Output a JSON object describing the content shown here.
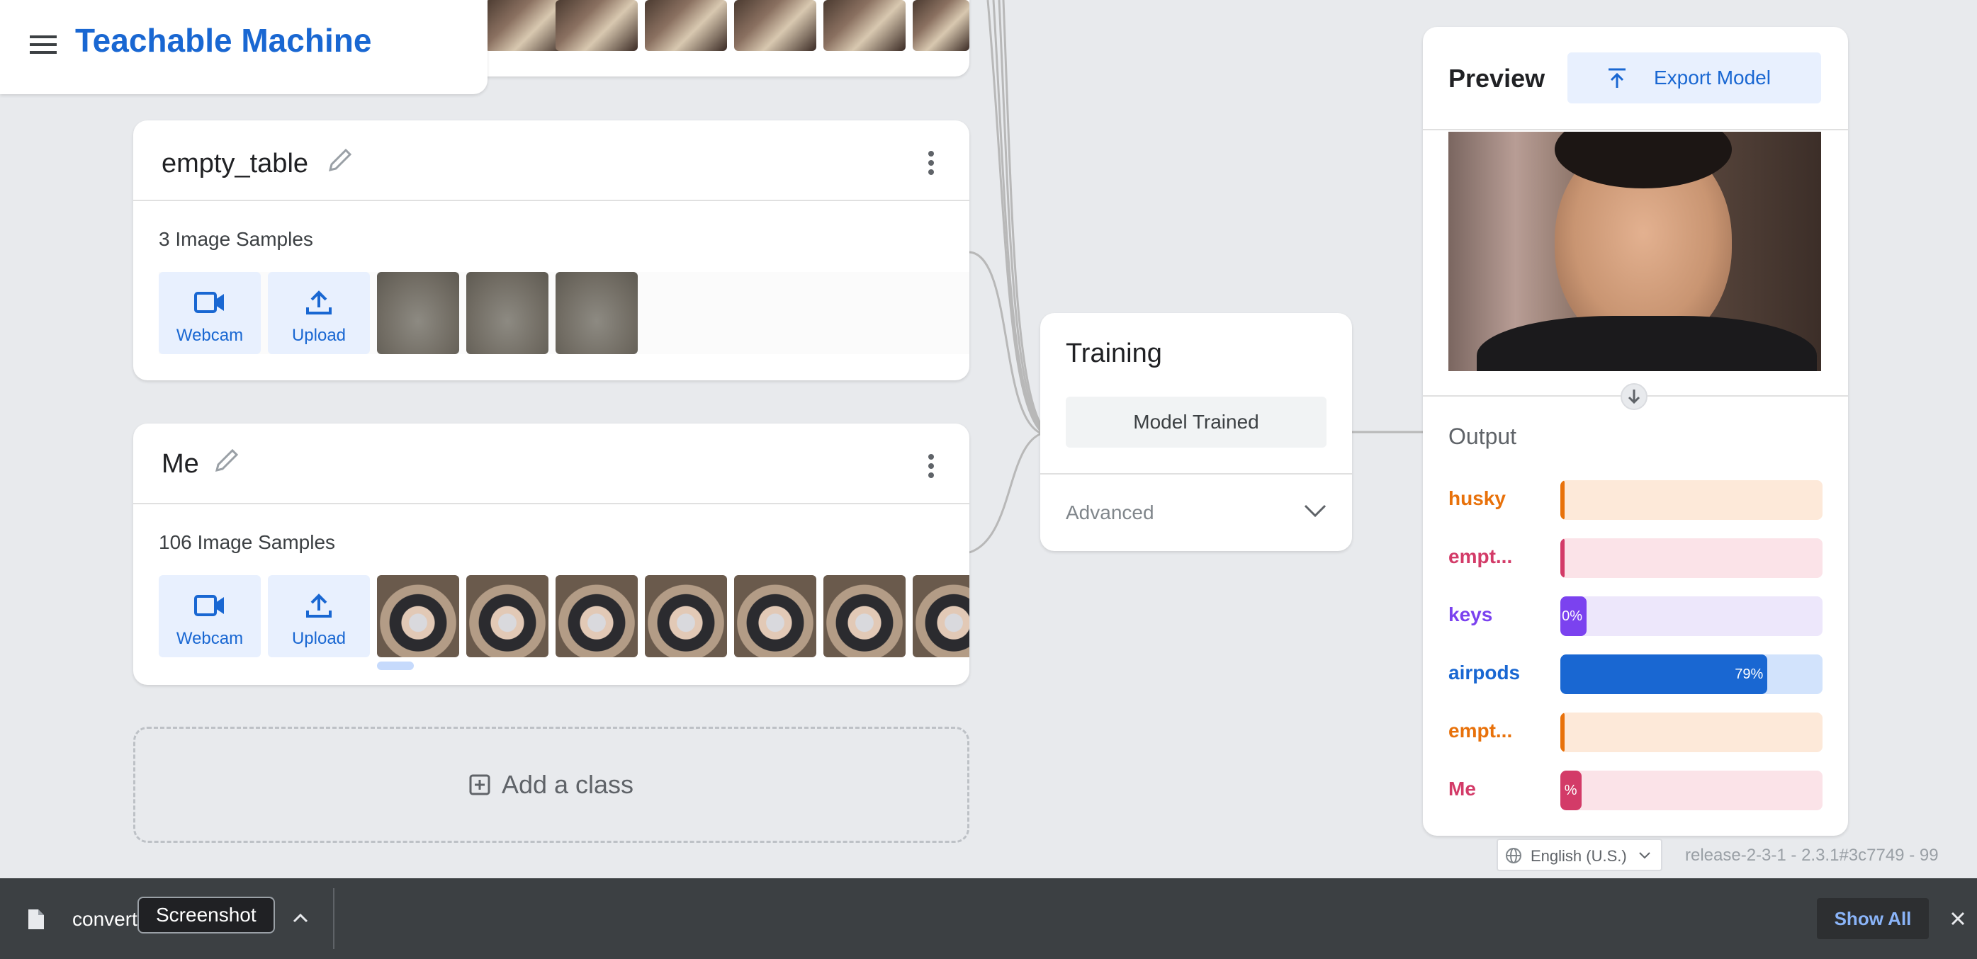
{
  "app": {
    "title": "Teachable Machine",
    "menu_icon": "hamburger-menu-icon"
  },
  "classes": [
    {
      "name": "empty_table",
      "sample_count_label": "3 Image Samples",
      "webcam_label": "Webcam",
      "upload_label": "Upload"
    },
    {
      "name": "Me",
      "sample_count_label": "106 Image Samples",
      "webcam_label": "Webcam",
      "upload_label": "Upload"
    }
  ],
  "add_class_label": "Add a class",
  "training": {
    "title": "Training",
    "status_button": "Model Trained",
    "advanced_label": "Advanced"
  },
  "preview": {
    "title": "Preview",
    "export_label": "Export Model",
    "output_title": "Output",
    "outputs": [
      {
        "label": "husky",
        "percent": 0,
        "percent_label": "",
        "color": "#e8710a",
        "track": "#fde9d9"
      },
      {
        "label": "empt...",
        "percent": 1,
        "percent_label": "",
        "color": "#d33b68",
        "track": "#fbe3e8"
      },
      {
        "label": "keys",
        "percent": 10,
        "percent_label": "0%",
        "color": "#7b42ef",
        "track": "#ede7fb"
      },
      {
        "label": "airpods",
        "percent": 79,
        "percent_label": "79%",
        "color": "#1967d2",
        "track": "#d2e3fc"
      },
      {
        "label": "empt...",
        "percent": 1,
        "percent_label": "",
        "color": "#e8710a",
        "track": "#fde9d9"
      },
      {
        "label": "Me",
        "percent": 8,
        "percent_label": "%",
        "color": "#d33b68",
        "track": "#fbe3e8"
      }
    ]
  },
  "footer": {
    "language": "English (U.S.)",
    "release": "release-2-3-1 - 2.3.1#3c7749 - 99"
  },
  "download_bar": {
    "file_name": "convert",
    "tooltip": "Screenshot",
    "show_all_label": "Show All"
  }
}
